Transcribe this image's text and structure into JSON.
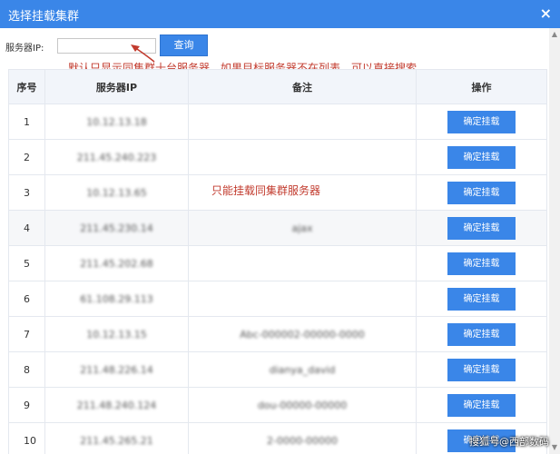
{
  "dialog": {
    "title": "选择挂载集群",
    "close_glyph": "×"
  },
  "search": {
    "label": "服务器IP:",
    "value": "",
    "placeholder": "",
    "button_label": "查询"
  },
  "annotations": {
    "top": "默认只显示同集群十台服务器，如果目标服务器不在列表，可以直接搜索",
    "middle": "只能挂载同集群服务器"
  },
  "table": {
    "headers": [
      "序号",
      "服务器IP",
      "备注",
      "操作"
    ],
    "rows": [
      {
        "index": "1",
        "ip": "10.12.13.18",
        "note": "",
        "action": "确定挂载"
      },
      {
        "index": "2",
        "ip": "211.45.240.223",
        "note": "",
        "action": "确定挂载"
      },
      {
        "index": "3",
        "ip": "10.12.13.65",
        "note": "",
        "action": "确定挂载"
      },
      {
        "index": "4",
        "ip": "211.45.230.14",
        "note": "ajax",
        "action": "确定挂载"
      },
      {
        "index": "5",
        "ip": "211.45.202.68",
        "note": "",
        "action": "确定挂载"
      },
      {
        "index": "6",
        "ip": "61.108.29.113",
        "note": "",
        "action": "确定挂载"
      },
      {
        "index": "7",
        "ip": "10.12.13.15",
        "note": "Abc-000002-00000-0000",
        "action": "确定挂载"
      },
      {
        "index": "8",
        "ip": "211.48.226.14",
        "note": "dianya_david",
        "action": "确定挂载"
      },
      {
        "index": "9",
        "ip": "211.48.240.124",
        "note": "dou-00000-00000",
        "action": "确定挂载"
      },
      {
        "index": "10",
        "ip": "211.45.265.21",
        "note": "2-0000-00000",
        "action": "确定挂载"
      }
    ]
  },
  "watermark": "搜狐号@西部数码",
  "colors": {
    "accent": "#3a86e8",
    "annotation": "#c23b2e",
    "header_bg": "#f2f5fa"
  }
}
